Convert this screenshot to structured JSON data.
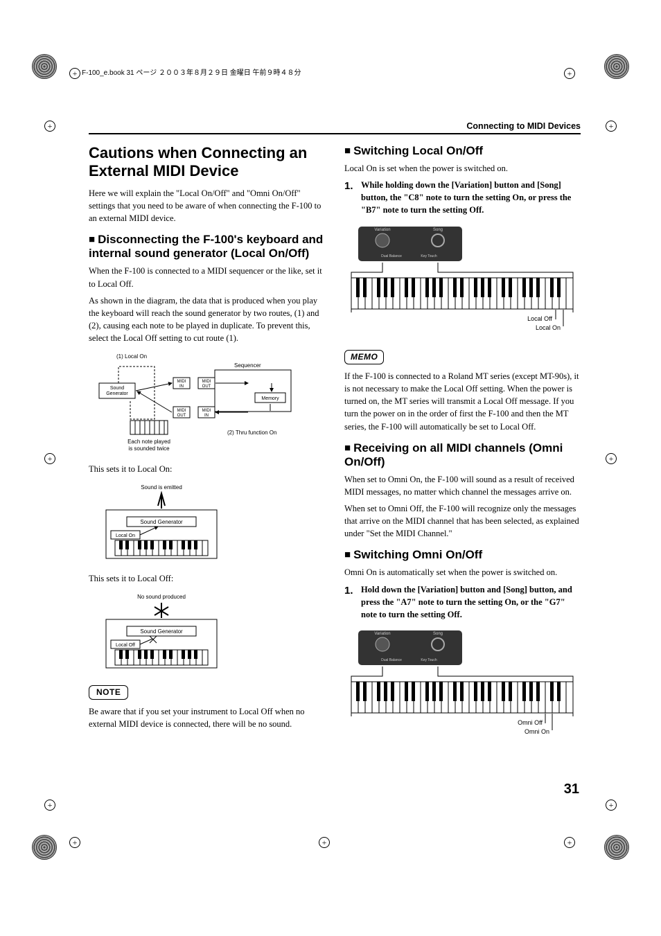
{
  "header_line": "F-100_e.book 31 ページ ２００３年８月２９日 金曜日 午前９時４８分",
  "section_header": "Connecting to MIDI Devices",
  "page_number": "31",
  "left": {
    "h1": "Cautions when Connecting an External MIDI Device",
    "intro": "Here we will explain the \"Local On/Off\" and \"Omni On/Off\" settings that you need to be aware of when connecting the F-100 to an external MIDI device.",
    "h2a": "Disconnecting the F-100's keyboard and internal sound generator (Local On/Off)",
    "p1": "When the F-100 is connected to a MIDI sequencer or the like, set it to Local Off.",
    "p2": "As shown in the diagram, the data that is produced when you play the keyboard will reach the sound generator by two routes, (1) and (2), causing each note to be played in duplicate. To prevent this, select the Local Off setting to cut route (1).",
    "diag1": {
      "local_on": "(1) Local On",
      "sequencer": "Sequencer",
      "sound_gen": "Sound\nGenerator",
      "midi_in": "MIDI\nIN",
      "midi_out": "MIDI\nOUT",
      "memory": "Memory",
      "thru": "(2) Thru function On",
      "twice": "Each note played\nis sounded twice"
    },
    "p3": "This sets it to Local On:",
    "diag2": {
      "emitted": "Sound is emitted",
      "sound_gen": "Sound Generator",
      "local_on": "Local On"
    },
    "p4": "This sets it to Local Off:",
    "diag3": {
      "no_sound": "No sound produced",
      "sound_gen": "Sound Generator",
      "local_off": "Local Off"
    },
    "note_label": "NOTE",
    "note_text": "Be aware that if you set your instrument to Local Off when no external MIDI device is connected, there will be no sound."
  },
  "right": {
    "h2a": "Switching Local On/Off",
    "p1": "Local On is set when the power is switched on.",
    "step1": "While holding down the [Variation] button and [Song] button, the \"C8\" note to turn the setting On, or press the \"B7\" note to turn the setting Off.",
    "kbd1": {
      "variation": "Variation",
      "song": "Song",
      "dual_balance": "Dual Balance",
      "key_touch": "Key Touch",
      "off": "Local Off",
      "on": "Local On"
    },
    "memo_label": "MEMO",
    "memo_text": "If the F-100 is connected to a Roland MT series (except MT-90s), it is not necessary to make the Local Off setting. When the power is turned on, the MT series will transmit a Local Off message. If you turn the power on in the order of first the F-100 and then the MT series, the F-100 will automatically be set to Local Off.",
    "h2b": "Receiving on all MIDI channels (Omni On/Off)",
    "p2": "When set to Omni On, the F-100 will sound as a result of received MIDI messages, no matter which channel the messages arrive on.",
    "p3": "When set to Omni Off, the F-100 will recognize only the messages that arrive on the MIDI channel that has been selected, as explained under \"Set the MIDI Channel.\"",
    "h2c": "Switching Omni On/Off",
    "p4": "Omni On is automatically set when the power is switched on.",
    "step2": "Hold down the [Variation] button and [Song] button, and press the \"A7\" note to turn the setting On, or the \"G7\" note to turn the setting Off.",
    "kbd2": {
      "variation": "Variation",
      "song": "Song",
      "dual_balance": "Dual Balance",
      "key_touch": "Key Touch",
      "off": "Omni Off",
      "on": "Omni On"
    }
  }
}
